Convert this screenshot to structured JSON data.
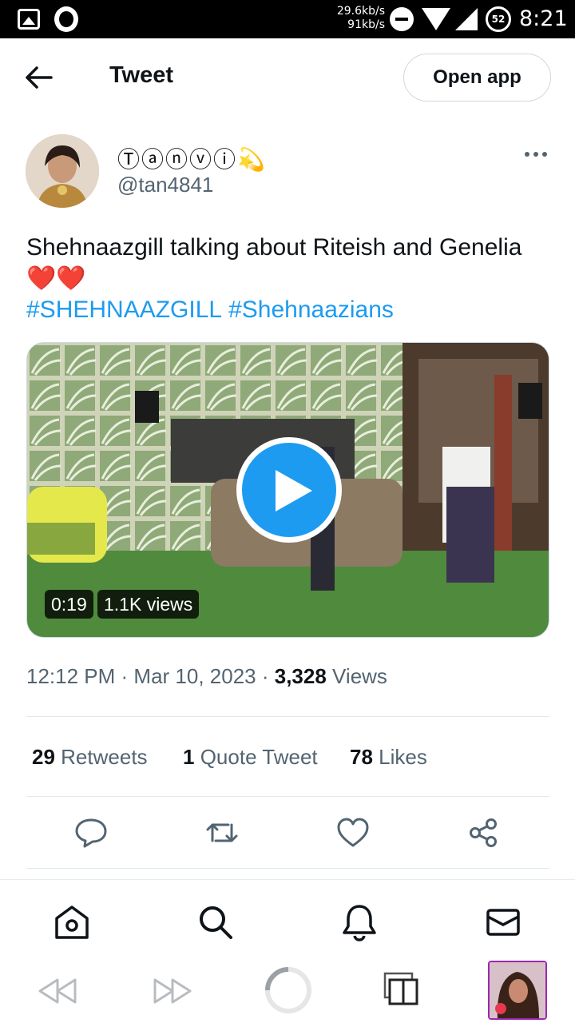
{
  "status_bar": {
    "net_up": "29.6kb/s",
    "net_down": "91kb/s",
    "battery": "52",
    "time": "8:21"
  },
  "header": {
    "title": "Tweet",
    "open_app_label": "Open app"
  },
  "author": {
    "display_name": "Ⓣⓐⓝⓥⓘ💫",
    "handle": "@tan4841"
  },
  "tweet": {
    "text": "Shehnaazgill talking about Riteish and Genelia ❤️❤️",
    "hashtags": [
      "#SHEHNAAZGILL",
      "#Shehnaazians"
    ],
    "video": {
      "duration": "0:19",
      "views": "1.1K views"
    },
    "time": "12:12 PM",
    "date": "Mar 10, 2023",
    "view_count": "3,328",
    "views_label": "Views"
  },
  "stats": {
    "retweets_count": "29",
    "retweets_label": "Retweets",
    "quotes_count": "1",
    "quotes_label": "Quote Tweet",
    "likes_count": "78",
    "likes_label": "Likes"
  },
  "colors": {
    "accent": "#1d9bf0",
    "text": "#0f1419",
    "secondary": "#536471"
  }
}
